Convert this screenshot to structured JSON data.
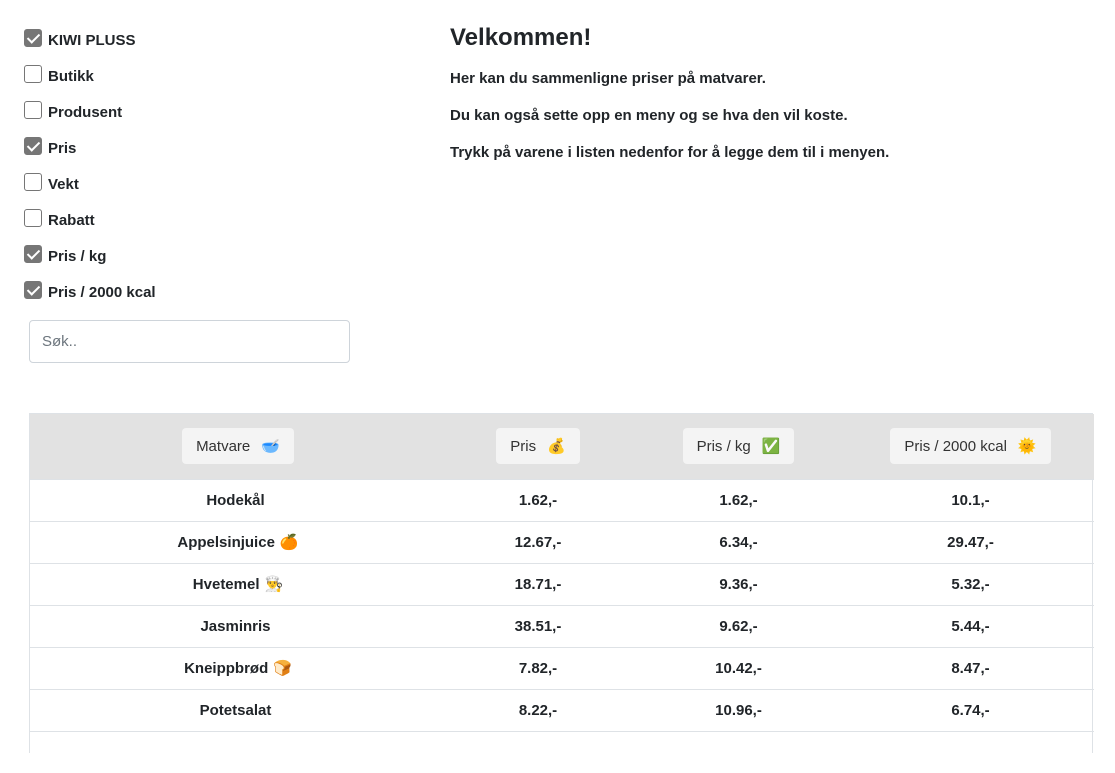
{
  "filters": [
    {
      "label": "KIWI PLUSS",
      "checked": true
    },
    {
      "label": "Butikk",
      "checked": false
    },
    {
      "label": "Produsent",
      "checked": false
    },
    {
      "label": "Pris",
      "checked": true
    },
    {
      "label": "Vekt",
      "checked": false
    },
    {
      "label": "Rabatt",
      "checked": false
    },
    {
      "label": "Pris / kg",
      "checked": true
    },
    {
      "label": "Pris / 2000 kcal",
      "checked": true
    }
  ],
  "search": {
    "placeholder": "Søk..",
    "value": ""
  },
  "welcome": {
    "title": "Velkommen!",
    "lines": [
      "Her kan du sammenligne priser på matvarer.",
      "Du kan også sette opp en meny og se hva den vil koste.",
      "Trykk på varene i listen nedenfor for å legge dem til i menyen."
    ]
  },
  "table": {
    "headers": [
      {
        "label": "Matvare",
        "emoji": "🥣"
      },
      {
        "label": "Pris",
        "emoji": "💰"
      },
      {
        "label": "Pris / kg",
        "emoji": "✅"
      },
      {
        "label": "Pris / 2000 kcal",
        "emoji": "🌞"
      }
    ],
    "rows": [
      {
        "name": "Hodekål",
        "emoji": "",
        "pris": "1.62,-",
        "pris_kg": "1.62,-",
        "pris_kcal": "10.1,-"
      },
      {
        "name": "Appelsinjuice",
        "emoji": "🍊",
        "pris": "12.67,-",
        "pris_kg": "6.34,-",
        "pris_kcal": "29.47,-"
      },
      {
        "name": "Hvetemel",
        "emoji": "👨‍🍳",
        "pris": "18.71,-",
        "pris_kg": "9.36,-",
        "pris_kcal": "5.32,-"
      },
      {
        "name": "Jasminris",
        "emoji": "",
        "pris": "38.51,-",
        "pris_kg": "9.62,-",
        "pris_kcal": "5.44,-"
      },
      {
        "name": "Kneippbrød",
        "emoji": "🍞",
        "pris": "7.82,-",
        "pris_kg": "10.42,-",
        "pris_kcal": "8.47,-"
      },
      {
        "name": "Potetsalat",
        "emoji": "",
        "pris": "8.22,-",
        "pris_kg": "10.96,-",
        "pris_kcal": "6.74,-"
      }
    ]
  }
}
